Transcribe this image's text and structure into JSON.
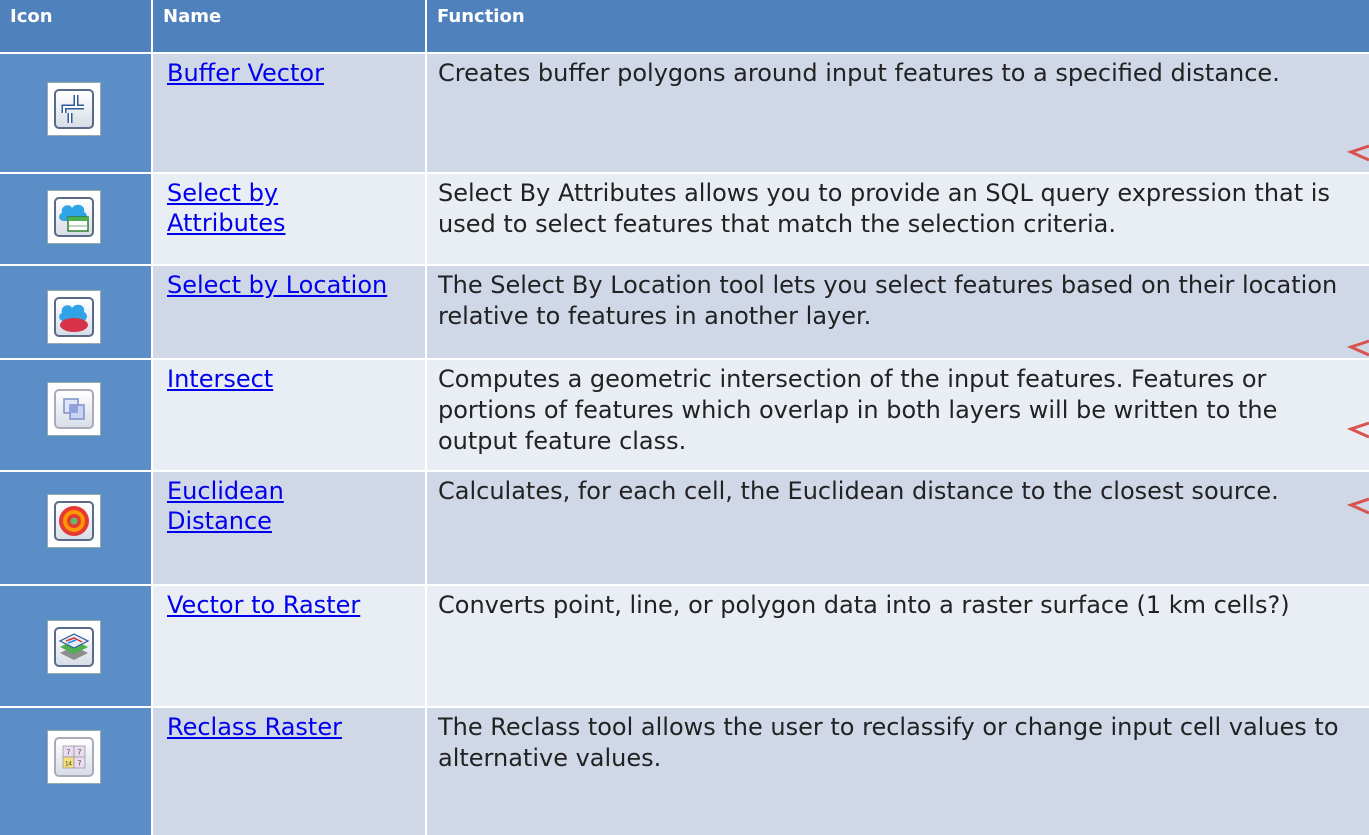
{
  "header": {
    "icon": "Icon",
    "name": "Name",
    "function": "Function"
  },
  "rows": [
    {
      "icon": "buffer-icon",
      "name": [
        "Buffer Vector"
      ],
      "desc": "Creates buffer polygons around input features to a specified distance."
    },
    {
      "icon": "select-by-attributes-icon",
      "name": [
        "Select by",
        "Attributes"
      ],
      "desc": "Select By Attributes allows you to provide an SQL query expression that is used to select features that match the selection criteria."
    },
    {
      "icon": "select-by-location-icon",
      "name": [
        "Select by Location"
      ],
      "desc": "The Select By Location tool lets you select features based on their location relative to features in another layer."
    },
    {
      "icon": "intersect-icon",
      "name": [
        "Intersect"
      ],
      "desc": "Computes a geometric intersection of the input features. Features or portions of features which overlap in both layers will be written to the output feature class."
    },
    {
      "icon": "euclidean-distance-icon",
      "name": [
        "Euclidean",
        "Distance"
      ],
      "desc": "Calculates, for each cell, the Euclidean distance to the closest source."
    },
    {
      "icon": "vector-to-raster-icon",
      "name": [
        "Vector to Raster"
      ],
      "desc": "Converts point, line, or polygon data into a raster surface (1 km cells?)"
    },
    {
      "icon": "reclass-raster-icon",
      "name": [
        "Reclass Raster"
      ],
      "desc": "The Reclass tool allows the user to reclassify or change input cell values to alternative values."
    }
  ],
  "reclass_icon_digits": [
    "7",
    "7",
    "14",
    "7"
  ],
  "colors": {
    "header": "#4f81bd",
    "icon_column": "#5b8ec7",
    "row_odd": "#d0d8e8",
    "row_even": "#e9edf4",
    "link": "#0000ee",
    "arrow": "#d9534f"
  }
}
